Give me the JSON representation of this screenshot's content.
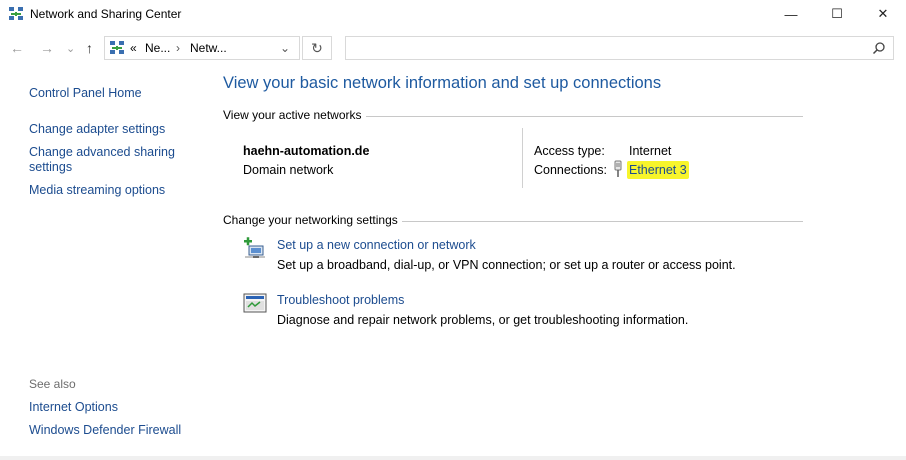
{
  "window": {
    "title": "Network and Sharing Center",
    "controls": {
      "minimize": "—",
      "maximize": "☐",
      "close": "✕"
    }
  },
  "nav": {
    "back": "←",
    "forward": "→",
    "dropdown": "⌄",
    "up": "↑",
    "address": {
      "overflow": "«",
      "segments": [
        "Ne...",
        "Netw..."
      ],
      "separator": "›",
      "chevron": "⌄"
    },
    "refresh": "↻",
    "search_placeholder": ""
  },
  "sidebar": {
    "home": "Control Panel Home",
    "links": [
      "Change adapter settings",
      "Change advanced sharing",
      "settings",
      "Media streaming options"
    ],
    "see_also_label": "See also",
    "see_also": [
      "Internet Options",
      "Windows Defender Firewall"
    ]
  },
  "main": {
    "heading": "View your basic network information and set up connections",
    "active_networks_label": "View your active networks",
    "network": {
      "name": "haehn-automation.de",
      "category": "Domain network",
      "access_type_label": "Access type:",
      "access_type_value": "Internet",
      "connections_label": "Connections:",
      "connection_link": "Ethernet 3"
    },
    "change_label": "Change your networking settings",
    "tasks": [
      {
        "title": "Set up a new connection or network",
        "desc": "Set up a broadband, dial-up, or VPN connection; or set up a router or access point."
      },
      {
        "title": "Troubleshoot problems",
        "desc": "Diagnose and repair network problems, or get troubleshooting information."
      }
    ]
  },
  "colors": {
    "link": "#1c4c8f",
    "heading": "#1e5aa0",
    "highlight": "#f7f52b"
  }
}
